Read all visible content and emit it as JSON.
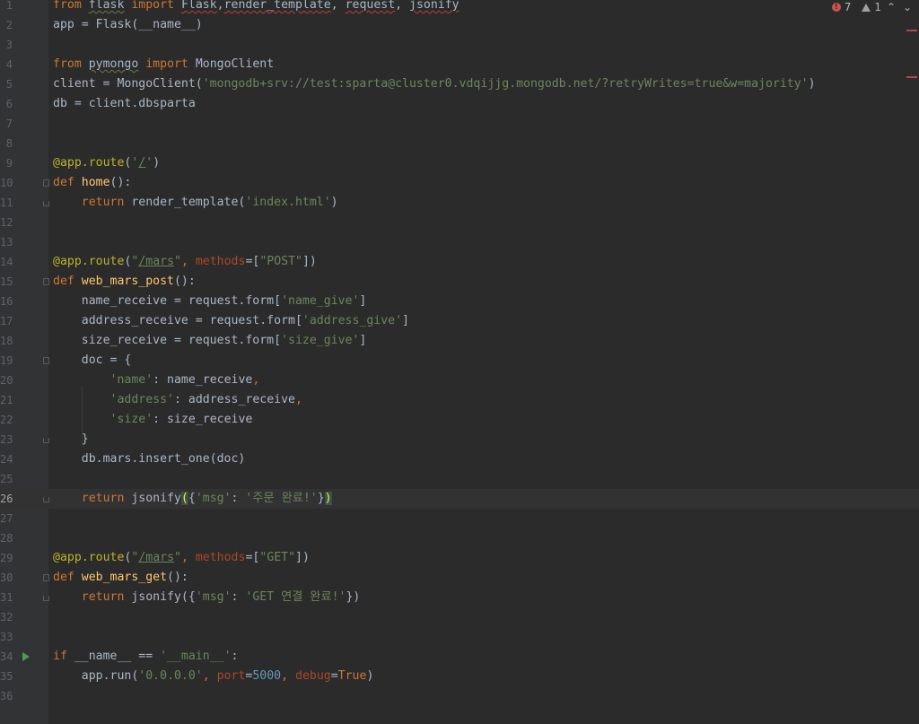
{
  "editor": {
    "indicators": {
      "errors": "7",
      "warnings": "1",
      "prev": "⌃",
      "next": "⌄"
    },
    "current_line": 26
  },
  "code_lines": [
    {
      "n": "1",
      "segments": [
        [
          "kw",
          "from "
        ],
        [
          "typo",
          "flask"
        ],
        [
          "kw",
          " import "
        ],
        [
          "squig",
          "Flask"
        ],
        [
          "",
          ","
        ],
        [
          "squig",
          "render_template"
        ],
        [
          "",
          ", "
        ],
        [
          "squig",
          "request"
        ],
        [
          "",
          ", "
        ],
        [
          "squig",
          "jsonify"
        ]
      ]
    },
    {
      "n": "2",
      "segments": [
        [
          "",
          "app = Flask(__name__)"
        ]
      ]
    },
    {
      "n": "3",
      "segments": []
    },
    {
      "n": "4",
      "segments": [
        [
          "kw",
          "from "
        ],
        [
          "typo",
          "pymongo"
        ],
        [
          "kw",
          " import "
        ],
        [
          "",
          "MongoClient"
        ]
      ]
    },
    {
      "n": "5",
      "segments": [
        [
          "",
          "client = MongoClient("
        ],
        [
          "str",
          "'mongodb+srv://test:sparta@cluster0.vdqijjg.mongodb.net/?retryWrites=true&w=majority'"
        ],
        [
          "",
          ")"
        ]
      ]
    },
    {
      "n": "6",
      "segments": [
        [
          "",
          "db = client.dbsparta"
        ]
      ]
    },
    {
      "n": "7",
      "segments": []
    },
    {
      "n": "8",
      "segments": []
    },
    {
      "n": "9",
      "segments": [
        [
          "dec",
          "@app.route"
        ],
        [
          "",
          "("
        ],
        [
          "str",
          "'"
        ],
        [
          "str under",
          "/"
        ],
        [
          "str",
          "'"
        ],
        [
          "",
          ")"
        ]
      ]
    },
    {
      "n": "10",
      "segments": [
        [
          "kw",
          "def "
        ],
        [
          "fn",
          "home"
        ],
        [
          "",
          "():"
        ]
      ]
    },
    {
      "n": "11",
      "segments": [
        [
          "",
          "    "
        ],
        [
          "kw",
          "return "
        ],
        [
          "",
          "render_template("
        ],
        [
          "str",
          "'index.html'"
        ],
        [
          "",
          ")"
        ]
      ]
    },
    {
      "n": "12",
      "segments": []
    },
    {
      "n": "13",
      "segments": []
    },
    {
      "n": "14",
      "segments": [
        [
          "dec",
          "@app.route"
        ],
        [
          "",
          "("
        ],
        [
          "str",
          "\""
        ],
        [
          "str under",
          "/mars"
        ],
        [
          "str",
          "\""
        ],
        [
          "kw",
          ", "
        ],
        [
          "param",
          "methods"
        ],
        [
          "",
          "=["
        ],
        [
          "str",
          "\"POST\""
        ],
        [
          "",
          "])"
        ]
      ]
    },
    {
      "n": "15",
      "segments": [
        [
          "kw",
          "def "
        ],
        [
          "fn",
          "web_mars_post"
        ],
        [
          "",
          "():"
        ]
      ]
    },
    {
      "n": "16",
      "segments": [
        [
          "",
          "    name_receive = request.form["
        ],
        [
          "str",
          "'name_give'"
        ],
        [
          "",
          "]"
        ]
      ]
    },
    {
      "n": "17",
      "segments": [
        [
          "",
          "    address_receive = request.form["
        ],
        [
          "str",
          "'address_give'"
        ],
        [
          "",
          "]"
        ]
      ]
    },
    {
      "n": "18",
      "segments": [
        [
          "",
          "    size_receive = request.form["
        ],
        [
          "str",
          "'size_give'"
        ],
        [
          "",
          "]"
        ]
      ]
    },
    {
      "n": "19",
      "segments": [
        [
          "",
          "    doc = {"
        ]
      ]
    },
    {
      "n": "20",
      "segments": [
        [
          "",
          "        "
        ],
        [
          "str",
          "'name'"
        ],
        [
          "",
          ": name_receive"
        ],
        [
          "kw",
          ","
        ]
      ]
    },
    {
      "n": "21",
      "segments": [
        [
          "",
          "        "
        ],
        [
          "str",
          "'address'"
        ],
        [
          "",
          ": address_receive"
        ],
        [
          "kw",
          ","
        ]
      ]
    },
    {
      "n": "22",
      "segments": [
        [
          "",
          "        "
        ],
        [
          "str",
          "'size'"
        ],
        [
          "",
          ": size_receive"
        ]
      ]
    },
    {
      "n": "23",
      "segments": [
        [
          "",
          "    }"
        ]
      ]
    },
    {
      "n": "24",
      "segments": [
        [
          "",
          "    db.mars.insert_one(doc)"
        ]
      ]
    },
    {
      "n": "25",
      "segments": []
    },
    {
      "n": "26",
      "segments": [
        [
          "",
          "    "
        ],
        [
          "kw",
          "return "
        ],
        [
          "",
          "jsonify"
        ],
        [
          "brace-hl",
          "("
        ],
        [
          "",
          "{"
        ],
        [
          "str",
          "'msg'"
        ],
        [
          "",
          ": "
        ],
        [
          "str",
          "'주문 완료!'"
        ],
        [
          "",
          "}"
        ],
        [
          "brace-hl",
          ")"
        ]
      ]
    },
    {
      "n": "27",
      "segments": []
    },
    {
      "n": "28",
      "segments": []
    },
    {
      "n": "29",
      "segments": [
        [
          "dec",
          "@app.route"
        ],
        [
          "",
          "("
        ],
        [
          "str",
          "\""
        ],
        [
          "str under",
          "/mars"
        ],
        [
          "str",
          "\""
        ],
        [
          "kw",
          ", "
        ],
        [
          "param",
          "methods"
        ],
        [
          "",
          "=["
        ],
        [
          "str",
          "\"GET\""
        ],
        [
          "",
          "])"
        ]
      ]
    },
    {
      "n": "30",
      "segments": [
        [
          "kw",
          "def "
        ],
        [
          "fn",
          "web_mars_get"
        ],
        [
          "",
          "():"
        ]
      ]
    },
    {
      "n": "31",
      "segments": [
        [
          "",
          "    "
        ],
        [
          "kw",
          "return "
        ],
        [
          "",
          "jsonify({"
        ],
        [
          "str",
          "'msg'"
        ],
        [
          "",
          ": "
        ],
        [
          "str",
          "'GET 연결 완료!'"
        ],
        [
          "",
          "})"
        ]
      ]
    },
    {
      "n": "32",
      "segments": []
    },
    {
      "n": "33",
      "segments": []
    },
    {
      "n": "34",
      "segments": [
        [
          "kw",
          "if "
        ],
        [
          "",
          "__name__ == "
        ],
        [
          "str",
          "'__main__'"
        ],
        [
          "",
          ":"
        ]
      ]
    },
    {
      "n": "35",
      "segments": [
        [
          "",
          "    app.run("
        ],
        [
          "str",
          "'0.0.0.0'"
        ],
        [
          "kw",
          ", "
        ],
        [
          "param",
          "port"
        ],
        [
          "",
          "="
        ],
        [
          "num",
          "5000"
        ],
        [
          "kw",
          ", "
        ],
        [
          "param",
          "debug"
        ],
        [
          "",
          "="
        ],
        [
          "kw",
          "True"
        ],
        [
          "",
          ")"
        ]
      ]
    },
    {
      "n": "36",
      "segments": []
    }
  ]
}
